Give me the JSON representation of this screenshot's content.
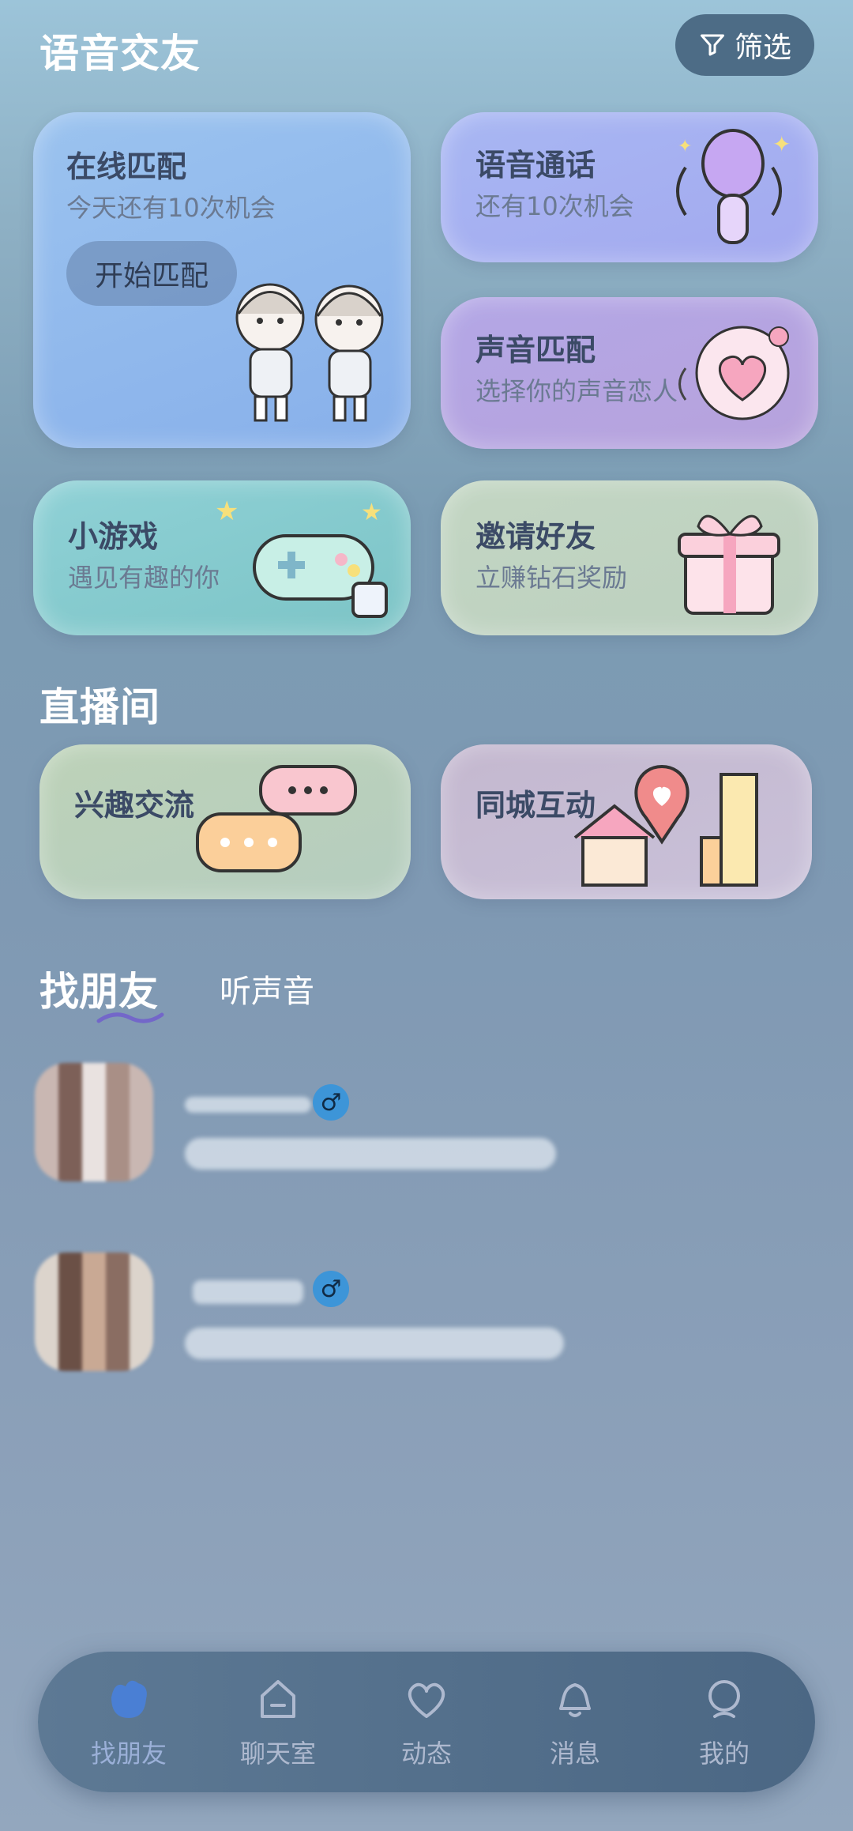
{
  "header": {
    "title": "语音交友",
    "filter_label": "筛选"
  },
  "cards": {
    "online_match": {
      "title": "在线匹配",
      "subtitle": "今天还有10次机会",
      "button": "开始匹配"
    },
    "voice_call": {
      "title": "语音通话",
      "subtitle": "还有10次机会"
    },
    "voice_match": {
      "title": "声音匹配",
      "subtitle": "选择你的声音恋人"
    },
    "mini_game": {
      "title": "小游戏",
      "subtitle": "遇见有趣的你"
    },
    "invite": {
      "title": "邀请好友",
      "subtitle": "立赚钻石奖励"
    }
  },
  "live": {
    "title": "直播间",
    "rooms": [
      {
        "title": "兴趣交流"
      },
      {
        "title": "同城互动"
      }
    ]
  },
  "friends": {
    "tabs": [
      {
        "label": "找朋友",
        "active": true
      },
      {
        "label": "听声音",
        "active": false
      }
    ],
    "gender_symbol": "♂"
  },
  "bottom_nav": {
    "items": [
      {
        "label": "找朋友",
        "icon": "home-blob-icon",
        "active": true
      },
      {
        "label": "聊天室",
        "icon": "house-icon",
        "active": false
      },
      {
        "label": "动态",
        "icon": "heart-icon",
        "active": false
      },
      {
        "label": "消息",
        "icon": "bell-icon",
        "active": false
      },
      {
        "label": "我的",
        "icon": "profile-icon",
        "active": false
      }
    ]
  },
  "colors": {
    "accent": "#3d95d8",
    "nav_bg": "#4b6784",
    "title_text": "#3b4a66"
  }
}
